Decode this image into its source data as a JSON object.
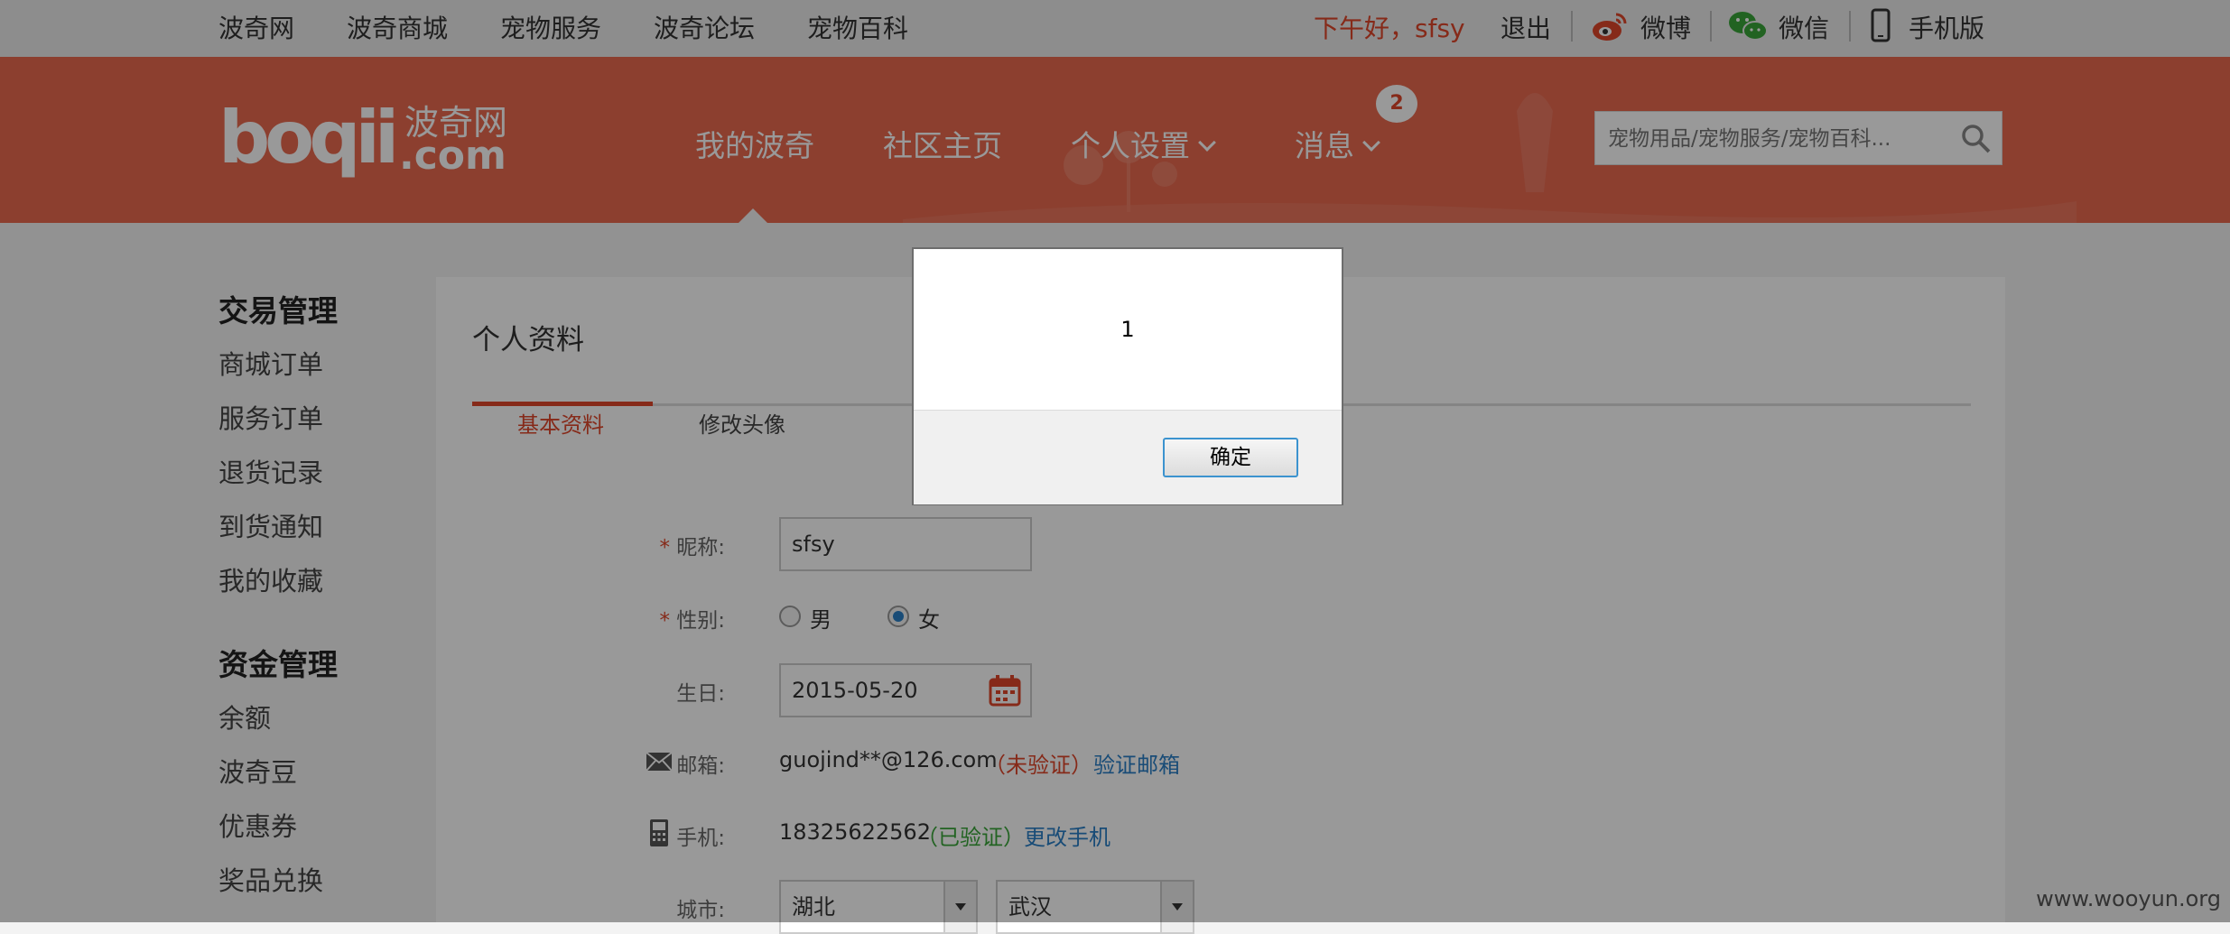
{
  "topbar": {
    "links": [
      "波奇网",
      "波奇商城",
      "宠物服务",
      "波奇论坛",
      "宠物百科"
    ],
    "greeting": "下午好，sfsy",
    "logout": "退出",
    "weibo": "微博",
    "weixin": "微信",
    "mobile": "手机版"
  },
  "header": {
    "logo_text": "boqii",
    "logo_cn": "波奇网",
    "logo_domain": ".com",
    "nav": [
      "我的波奇",
      "社区主页",
      "个人设置",
      "消息"
    ],
    "message_count": "2",
    "search_placeholder": "宠物用品/宠物服务/宠物百科..."
  },
  "sidebar": {
    "sections": [
      {
        "title": "交易管理",
        "items": [
          "商城订单",
          "服务订单",
          "退货记录",
          "到货通知",
          "我的收藏"
        ]
      },
      {
        "title": "资金管理",
        "items": [
          "余额",
          "波奇豆",
          "优惠券",
          "奖品兑换"
        ]
      }
    ]
  },
  "main": {
    "title": "个人资料",
    "tabs": [
      "基本资料",
      "修改头像"
    ],
    "form": {
      "nickname_label": "昵称:",
      "nickname_value": "sfsy",
      "gender_label": "性别:",
      "gender_options": [
        "男",
        "女"
      ],
      "gender_selected": "女",
      "birthday_label": "生日:",
      "birthday_value": "2015-05-20",
      "email_label": "邮箱:",
      "email_value": "guojind**@126.com",
      "email_status": "（未验证）",
      "email_action": "验证邮箱",
      "phone_label": "手机:",
      "phone_value": "18325622562",
      "phone_status": "（已验证）",
      "phone_action": "更改手机",
      "city_label": "城市:",
      "province_value": "湖北",
      "city_value": "武汉"
    }
  },
  "dialog": {
    "message": "1",
    "ok_label": "确定"
  },
  "watermark": "www.wooyun.org",
  "colors": {
    "brand": "#e9694f",
    "accent_red": "#e0462b",
    "link_blue": "#2a7fc6",
    "verified_green": "#3aa63a"
  }
}
